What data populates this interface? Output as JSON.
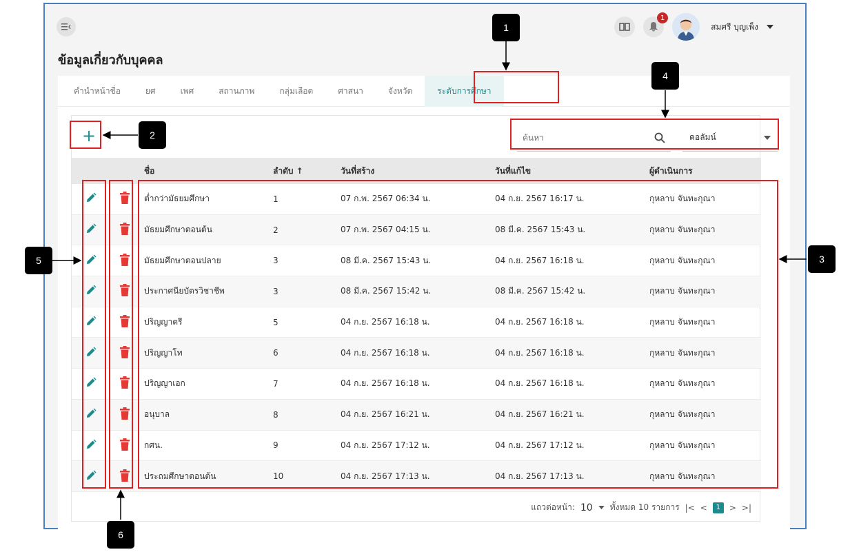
{
  "header": {
    "user_name": "สมศรี บุญเพ็ง",
    "notification_count": "1"
  },
  "page_title": "ข้อมูลเกี่ยวกับบุคคล",
  "tabs": [
    {
      "label": "คำนำหน้าชื่อ"
    },
    {
      "label": "ยศ"
    },
    {
      "label": "เพศ"
    },
    {
      "label": "สถานภาพ"
    },
    {
      "label": "กลุ่มเลือด"
    },
    {
      "label": "ศาสนา"
    },
    {
      "label": "จังหวัด"
    },
    {
      "label": "ระดับการศึกษา",
      "active": true
    }
  ],
  "toolbar": {
    "add_label": "+",
    "search_placeholder": "ค้นหา",
    "column_select": "คอลัมน์"
  },
  "table": {
    "headers": {
      "name": "ชื่อ",
      "order": "ลำดับ ↑",
      "created": "วันที่สร้าง",
      "updated": "วันที่แก้ไข",
      "by": "ผู้ดำเนินการ"
    },
    "rows": [
      {
        "name": "ต่ำกว่ามัธยมศึกษา",
        "order": "1",
        "created": "07 ก.พ. 2567 06:34 น.",
        "updated": "04 ก.ย. 2567 16:17 น.",
        "by": "กุหลาบ จันทะกุณา"
      },
      {
        "name": "มัธยมศึกษาตอนต้น",
        "order": "2",
        "created": "07 ก.พ. 2567 04:15 น.",
        "updated": "08 มี.ค. 2567 15:43 น.",
        "by": "กุหลาบ จันทะกุณา"
      },
      {
        "name": "มัธยมศึกษาตอนปลาย",
        "order": "3",
        "created": "08 มี.ค. 2567 15:43 น.",
        "updated": "04 ก.ย. 2567 16:18 น.",
        "by": "กุหลาบ จันทะกุณา"
      },
      {
        "name": "ประกาศนียบัตรวิชาชีพ",
        "order": "3",
        "created": "08 มี.ค. 2567 15:42 น.",
        "updated": "08 มี.ค. 2567 15:42 น.",
        "by": "กุหลาบ จันทะกุณา"
      },
      {
        "name": "ปริญญาตรี",
        "order": "5",
        "created": "04 ก.ย. 2567 16:18 น.",
        "updated": "04 ก.ย. 2567 16:18 น.",
        "by": "กุหลาบ จันทะกุณา"
      },
      {
        "name": "ปริญญาโท",
        "order": "6",
        "created": "04 ก.ย. 2567 16:18 น.",
        "updated": "04 ก.ย. 2567 16:18 น.",
        "by": "กุหลาบ จันทะกุณา"
      },
      {
        "name": "ปริญญาเอก",
        "order": "7",
        "created": "04 ก.ย. 2567 16:18 น.",
        "updated": "04 ก.ย. 2567 16:18 น.",
        "by": "กุหลาบ จันทะกุณา"
      },
      {
        "name": "อนุบาล",
        "order": "8",
        "created": "04 ก.ย. 2567 16:21 น.",
        "updated": "04 ก.ย. 2567 16:21 น.",
        "by": "กุหลาบ จันทะกุณา"
      },
      {
        "name": "กศน.",
        "order": "9",
        "created": "04 ก.ย. 2567 17:12 น.",
        "updated": "04 ก.ย. 2567 17:12 น.",
        "by": "กุหลาบ จันทะกุณา"
      },
      {
        "name": "ประถมศึกษาตอนต้น",
        "order": "10",
        "created": "04 ก.ย. 2567 17:13 น.",
        "updated": "04 ก.ย. 2567 17:13 น.",
        "by": "กุหลาบ จันทะกุณา"
      }
    ]
  },
  "pagination": {
    "rows_per_page_label": "แถวต่อหน้า:",
    "rows_per_page": "10",
    "total_label": "ทั้งหมด 10 รายการ",
    "current_page": "1"
  },
  "callouts": [
    "1",
    "2",
    "3",
    "4",
    "5",
    "6"
  ],
  "colors": {
    "accent": "#1d8a8d",
    "delete": "#e53935",
    "highlight": "#e02020",
    "frame": "#4a7fc1"
  }
}
